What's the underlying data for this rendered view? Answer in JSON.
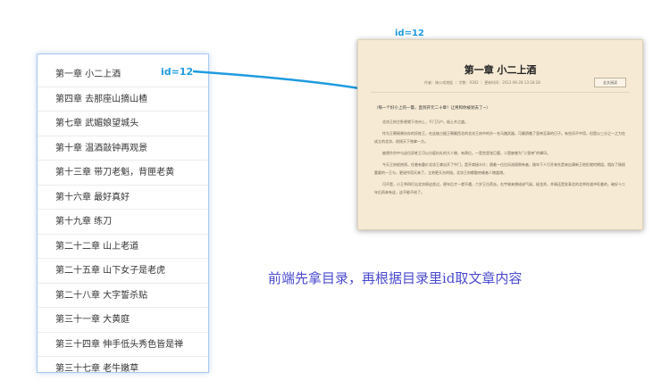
{
  "toc": {
    "items": [
      "第一章 小二上酒",
      "第四章 去那座山摘山楂",
      "第七章 武媚娘望城头",
      "第十章 温酒敲钟再观景",
      "第十三章 带刀老魁，背匣老黄",
      "第十六章 最好真好",
      "第十九章 练刀",
      "第二十二章 山上老道",
      "第二十五章 山下女子是老虎",
      "第二十八章 大字誓杀贴",
      "第三十一章 大黄庭",
      "第三十四章 伸手低头秀色皆是禅",
      "第三十七章 老牛嫩草"
    ]
  },
  "labels": {
    "id_left": "id=12",
    "id_top": "id=12"
  },
  "article": {
    "title": "第一章 小二上酒",
    "meta": "作者：烽火戏诸侯 ｜ 字数：9302 ｜ 更新时间：2012-06-28 13:18:28",
    "button": "全文阅读",
    "lead": "（每一个好小上的一瞥，直到开元二十章！让男和你被划去了~）",
    "paragraphs": [
      "北凉王府主卧便就于凉州上，千门万户，极土木之盛。",
      "作为王朝硕果仅存的异姓王，在这座占据王朝最西北的北凉王府中的孙一名马踏武器，可最骄傲了皇帝至高的日子。有些风不中用，但是以三分之一之力在成立的北凉，权倾天下独掌一方。",
      "被视作京中与这位异姓王可以分庭抗礼的大人物，有两位，一是宫里张巨鹿，二是被誉为“二皇帝”的掌印。",
      "今天王府很热闹，住着有重价北凉王拿自开了中门，是开席接众什；随着一位位风流雨侧有者，刚年下人引开来先是来自满新王地形就的拥组，相存了刚很重要的一王与，更说作用天来了，立刻更天光的秘。北凉王府都懿府威者人物盖增。",
      "可不是，小王爷四打出北凉原这贫过，便年后才一就不遇，六岁王位荷去。右宇刚来想成成气候，极龙秀，并阁还是发表北的北举柱道冲旺着的，碗好十二年后再来有这，这不能不给了。"
    ]
  },
  "caption": "前端先拿目录，再根据目录里id取文章内容",
  "colors": {
    "toc_border": "#a9c9ef",
    "accent_blue": "#1e9be0",
    "article_bg": "#f6ead4",
    "caption": "#4a4ad0"
  }
}
